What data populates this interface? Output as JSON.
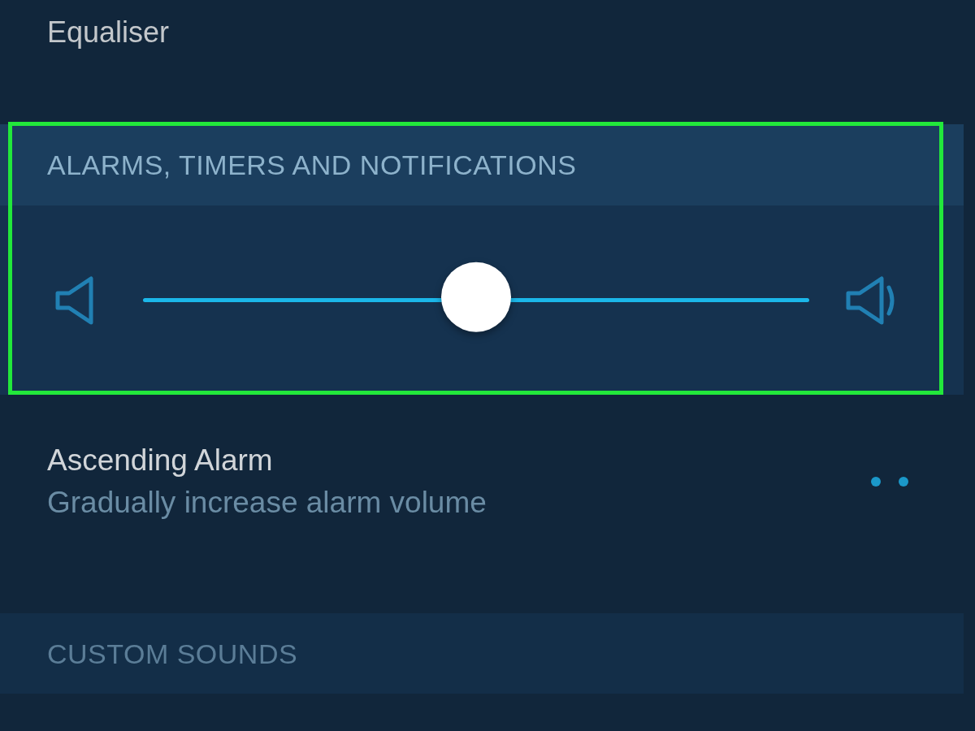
{
  "equaliser_row": {
    "title": "Equaliser"
  },
  "alarms_section": {
    "heading": "ALARMS, TIMERS AND NOTIFICATIONS",
    "highlighted": true,
    "volume_slider": {
      "level": 0.5
    }
  },
  "ascending_alarm": {
    "title": "Ascending Alarm",
    "subtitle": "Gradually increase alarm volume"
  },
  "custom_sounds": {
    "heading": "CUSTOM SOUNDS"
  }
}
